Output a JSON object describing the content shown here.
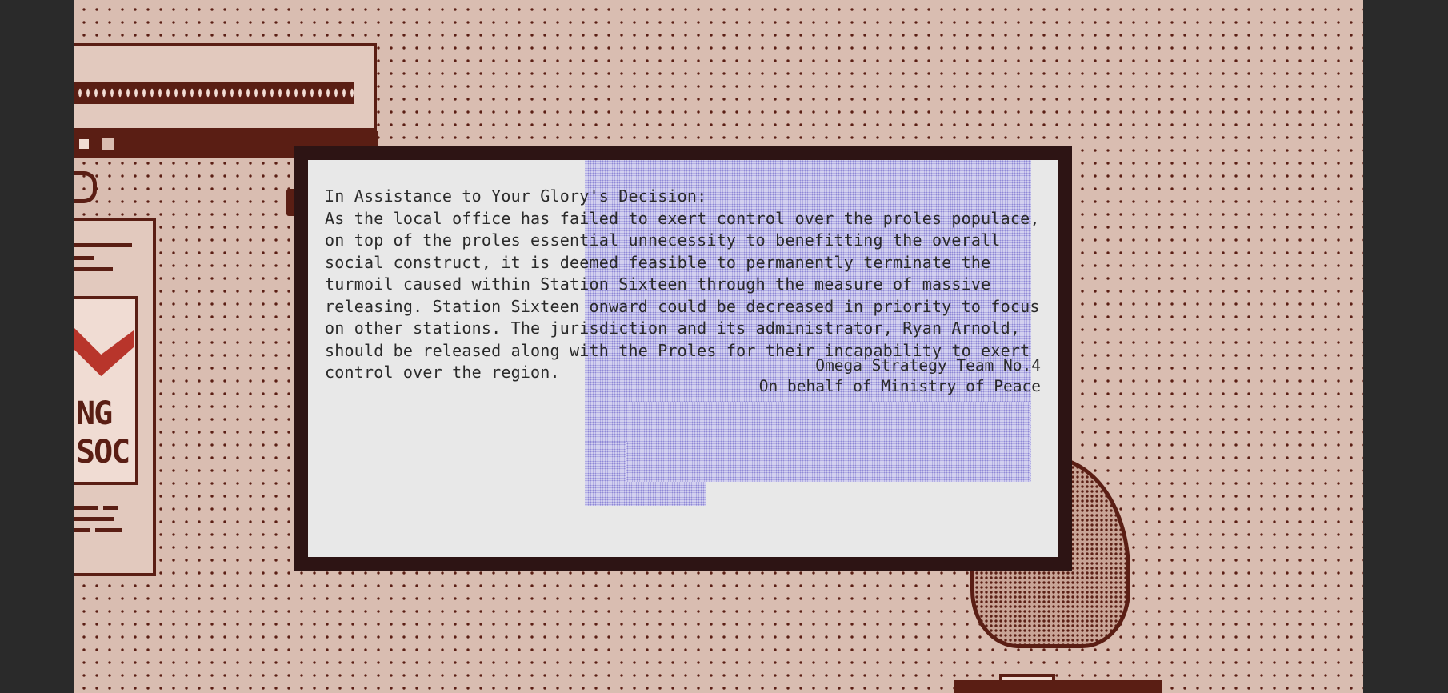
{
  "letter": {
    "heading": "In Assistance to Your Glory's Decision:",
    "body": "As the local office has failed to exert control over the proles populace, on top of the proles essential unnecessity to benefitting the overall social construct, it is deemed feasible to permanently terminate the turmoil caused within Station Sixteen through the measure of massive releasing. Station Sixteen onward could be decreased in priority to focus on other stations. The jurisdiction and its administrator, Ryan Arnold, should be released along with the Proles for their incapability to exert control over the region.",
    "signature_line1": "Omega Strategy Team No.4",
    "signature_line2": "On behalf of Ministry of Peace"
  },
  "poster": {
    "text_line1": "NG",
    "text_line2": "SOC"
  },
  "colors": {
    "background": "#d9bdb1",
    "dark_brown": "#5a1e14",
    "paper": "#e8e8e8",
    "logo_lavender": "#d6d3f0",
    "accent_red": "#b8352b"
  }
}
